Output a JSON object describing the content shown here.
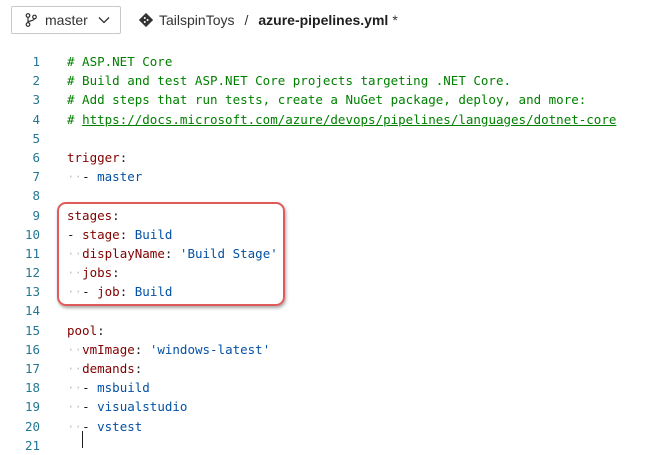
{
  "branch": {
    "label": "master",
    "icon": "git-branch-icon"
  },
  "breadcrumb": {
    "repo": "TailspinToys",
    "separator": "/",
    "file": "azure-pipelines.yml",
    "modified": "*"
  },
  "editor": {
    "lines": [
      {
        "n": "1",
        "parts": [
          {
            "t": "# ASP.NET Core",
            "c": "c-comment"
          }
        ]
      },
      {
        "n": "2",
        "parts": [
          {
            "t": "# Build and test ASP.NET Core projects targeting .NET Core.",
            "c": "c-comment"
          }
        ]
      },
      {
        "n": "3",
        "parts": [
          {
            "t": "# Add steps that run tests, create a NuGet package, deploy, and more:",
            "c": "c-comment"
          }
        ]
      },
      {
        "n": "4",
        "parts": [
          {
            "t": "# ",
            "c": "c-comment"
          },
          {
            "t": "https://docs.microsoft.com/azure/devops/pipelines/languages/dotnet-core",
            "c": "c-link"
          }
        ]
      },
      {
        "n": "5",
        "parts": []
      },
      {
        "n": "6",
        "parts": [
          {
            "t": "trigger",
            "c": "c-key"
          },
          {
            "t": ":",
            "c": "c-punct"
          }
        ]
      },
      {
        "n": "7",
        "parts": [
          {
            "t": "  ",
            "c": "ws"
          },
          {
            "t": "- ",
            "c": "c-punct"
          },
          {
            "t": "master",
            "c": "c-val"
          }
        ]
      },
      {
        "n": "8",
        "parts": []
      },
      {
        "n": "9",
        "parts": [
          {
            "t": "stages",
            "c": "c-key"
          },
          {
            "t": ":",
            "c": "c-punct"
          }
        ]
      },
      {
        "n": "10",
        "parts": [
          {
            "t": "- ",
            "c": "c-punct"
          },
          {
            "t": "stage",
            "c": "c-key"
          },
          {
            "t": ": ",
            "c": "c-punct"
          },
          {
            "t": "Build",
            "c": "c-val"
          }
        ]
      },
      {
        "n": "11",
        "parts": [
          {
            "t": "  ",
            "c": "ws"
          },
          {
            "t": "displayName",
            "c": "c-key"
          },
          {
            "t": ": ",
            "c": "c-punct"
          },
          {
            "t": "'Build Stage'",
            "c": "c-str"
          }
        ]
      },
      {
        "n": "12",
        "parts": [
          {
            "t": "  ",
            "c": "ws"
          },
          {
            "t": "jobs",
            "c": "c-key"
          },
          {
            "t": ":",
            "c": "c-punct"
          }
        ]
      },
      {
        "n": "13",
        "parts": [
          {
            "t": "  ",
            "c": "ws"
          },
          {
            "t": "- ",
            "c": "c-punct"
          },
          {
            "t": "job",
            "c": "c-key"
          },
          {
            "t": ": ",
            "c": "c-punct"
          },
          {
            "t": "Build",
            "c": "c-val"
          }
        ]
      },
      {
        "n": "14",
        "parts": []
      },
      {
        "n": "15",
        "parts": [
          {
            "t": "pool",
            "c": "c-key"
          },
          {
            "t": ":",
            "c": "c-punct"
          }
        ]
      },
      {
        "n": "16",
        "parts": [
          {
            "t": "  ",
            "c": "ws"
          },
          {
            "t": "vmImage",
            "c": "c-key"
          },
          {
            "t": ": ",
            "c": "c-punct"
          },
          {
            "t": "'windows-latest'",
            "c": "c-str"
          }
        ]
      },
      {
        "n": "17",
        "parts": [
          {
            "t": "  ",
            "c": "ws"
          },
          {
            "t": "demands",
            "c": "c-key"
          },
          {
            "t": ":",
            "c": "c-punct"
          }
        ]
      },
      {
        "n": "18",
        "parts": [
          {
            "t": "  ",
            "c": "ws"
          },
          {
            "t": "- ",
            "c": "c-punct"
          },
          {
            "t": "msbuild",
            "c": "c-val"
          }
        ]
      },
      {
        "n": "19",
        "parts": [
          {
            "t": "  ",
            "c": "ws"
          },
          {
            "t": "- ",
            "c": "c-punct"
          },
          {
            "t": "visualstudio",
            "c": "c-val"
          }
        ]
      },
      {
        "n": "20",
        "parts": [
          {
            "t": "  ",
            "c": "ws"
          },
          {
            "t": "- ",
            "c": "c-punct"
          },
          {
            "t": "vstest",
            "c": "c-val"
          }
        ]
      },
      {
        "n": "21",
        "parts": []
      }
    ]
  },
  "colors": {
    "highlight_border": "#e15a5a",
    "line_number": "#237893",
    "comment": "#008000",
    "key": "#800000",
    "value": "#0451a5"
  }
}
